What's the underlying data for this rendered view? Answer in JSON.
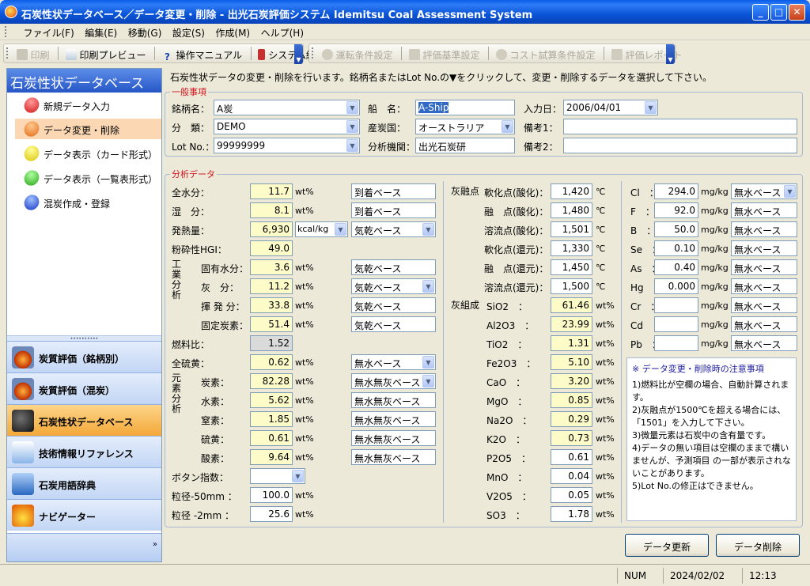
{
  "window": {
    "title": "石炭性状データベース／データ変更・削除 - 出光石炭評価システム Idemitsu Coal Assessment System",
    "min": "_",
    "max": "□",
    "close": "✕"
  },
  "menu": [
    "ファイル(F)",
    "編集(E)",
    "移動(G)",
    "設定(S)",
    "作成(M)",
    "ヘルプ(H)"
  ],
  "toolbar1": [
    "印刷",
    "印刷プレビュー",
    "操作マニュアル",
    "システム終了"
  ],
  "toolbar2": [
    "運転条件設定",
    "評価基準設定",
    "コスト試算条件設定",
    "評価レポート"
  ],
  "sidebar": {
    "header": "石炭性状データベース",
    "items": [
      "新規データ入力",
      "データ変更・削除",
      "データ表示（カード形式）",
      "データ表示（一覧表形式）",
      "混炭作成・登録"
    ],
    "groups": [
      "炭質評価（銘柄別）",
      "炭質評価（混炭）",
      "石炭性状データベース",
      "技術情報リファレンス",
      "石炭用語辞典",
      "ナビゲーター"
    ],
    "more": "»"
  },
  "description": "石炭性状データの変更・削除を行います。銘柄名またはLot No.の▼をクリックして、変更・削除するデータを選択して下さい。",
  "general": {
    "legend": "一般事項",
    "brand_label": "銘柄名：",
    "brand": "A炭",
    "class_label": "分　類：",
    "class": "DEMO",
    "lot_label": "Lot No.：",
    "lot": "99999999",
    "ship_label": "船　名：",
    "ship": "A-Ship",
    "country_label": "産炭国：",
    "country": "オーストラリア",
    "org_label": "分析機関：",
    "org": "出光石炭研",
    "date_label": "入力日：",
    "date": "2006/04/01",
    "note1_label": "備考1：",
    "note1": "",
    "note2_label": "備考2：",
    "note2": ""
  },
  "analysis": {
    "legend": "分析データ",
    "left": [
      {
        "l": "全水分：",
        "v": "11.7",
        "u": "wt%",
        "b": "到着ベース",
        "bd": false
      },
      {
        "l": "湿　分：",
        "v": "8.1",
        "u": "wt%",
        "b": "到着ベース",
        "bd": false
      },
      {
        "l": "発熱量：",
        "v": "6,930",
        "u": "kcal/kg",
        "b": "気乾ベース",
        "bd": true
      },
      {
        "l": "粉砕性HGI：",
        "v": "49.0",
        "u": "",
        "b": "",
        "bd": false
      },
      {
        "l": "固有水分：",
        "v": "3.6",
        "u": "wt%",
        "b": "気乾ベース",
        "bd": false
      },
      {
        "l": "灰　分：",
        "v": "11.2",
        "u": "wt%",
        "b": "気乾ベース",
        "bd": true
      },
      {
        "l": "揮 発 分：",
        "v": "33.8",
        "u": "wt%",
        "b": "気乾ベース",
        "bd": false
      },
      {
        "l": "固定炭素：",
        "v": "51.4",
        "u": "wt%",
        "b": "気乾ベース",
        "bd": false
      },
      {
        "l": "燃料比：",
        "v": "1.52",
        "u": "",
        "b": "",
        "bd": false
      },
      {
        "l": "全硫黄：",
        "v": "0.62",
        "u": "wt%",
        "b": "無水ベース",
        "bd": true
      },
      {
        "l": "炭素：",
        "v": "82.28",
        "u": "wt%",
        "b": "無水無灰ベース",
        "bd": true
      },
      {
        "l": "水素：",
        "v": "5.62",
        "u": "wt%",
        "b": "無水無灰ベース",
        "bd": false
      },
      {
        "l": "窒素：",
        "v": "1.85",
        "u": "wt%",
        "b": "無水無灰ベース",
        "bd": false
      },
      {
        "l": "硫黄：",
        "v": "0.61",
        "u": "wt%",
        "b": "無水無灰ベース",
        "bd": false
      },
      {
        "l": "酸素：",
        "v": "9.64",
        "u": "wt%",
        "b": "無水無灰ベース",
        "bd": false
      },
      {
        "l": "ボタン指数：",
        "v": "",
        "u": "",
        "b": "",
        "bd": false
      },
      {
        "l": "粒径-50mm ：",
        "v": "100.0",
        "u": "wt%",
        "b": "",
        "bd": false
      },
      {
        "l": "粒径 -2mm ：",
        "v": "25.6",
        "u": "wt%",
        "b": "",
        "bd": false
      }
    ],
    "group_industrial": "工業分析",
    "group_elemental": "元素分析",
    "ash_fusion_label": "灰融点",
    "ash_comp_label": "灰組成",
    "middle": [
      {
        "l": "軟化点(酸化)：",
        "v": "1,420",
        "u": "℃"
      },
      {
        "l": "融　点(酸化)：",
        "v": "1,480",
        "u": "℃"
      },
      {
        "l": "溶流点(酸化)：",
        "v": "1,501",
        "u": "℃"
      },
      {
        "l": "軟化点(還元)：",
        "v": "1,330",
        "u": "℃"
      },
      {
        "l": "融　点(還元)：",
        "v": "1,450",
        "u": "℃"
      },
      {
        "l": "溶流点(還元)：",
        "v": "1,500",
        "u": "℃"
      },
      {
        "l": "SiO2　：",
        "v": "61.46",
        "u": "wt%"
      },
      {
        "l": "Al2O3　：",
        "v": "23.99",
        "u": "wt%"
      },
      {
        "l": "TiO2　：",
        "v": "1.31",
        "u": "wt%"
      },
      {
        "l": "Fe2O3　：",
        "v": "5.10",
        "u": "wt%"
      },
      {
        "l": "CaO　：",
        "v": "3.20",
        "u": "wt%"
      },
      {
        "l": "MgO　：",
        "v": "0.85",
        "u": "wt%"
      },
      {
        "l": "Na2O　：",
        "v": "0.29",
        "u": "wt%"
      },
      {
        "l": "K2O　：",
        "v": "0.73",
        "u": "wt%"
      },
      {
        "l": "P2O5　：",
        "v": "0.61",
        "u": "wt%"
      },
      {
        "l": "MnO　：",
        "v": "0.04",
        "u": "wt%"
      },
      {
        "l": "V2O5　：",
        "v": "0.05",
        "u": "wt%"
      },
      {
        "l": "SO3　：",
        "v": "1.78",
        "u": "wt%"
      }
    ],
    "right": [
      {
        "l": "Cl　：",
        "v": "294.0",
        "u": "mg/kg",
        "b": "無水ベース",
        "bd": true
      },
      {
        "l": "F　：",
        "v": "92.0",
        "u": "mg/kg",
        "b": "無水ベース",
        "bd": false
      },
      {
        "l": "B　：",
        "v": "50.0",
        "u": "mg/kg",
        "b": "無水ベース",
        "bd": false
      },
      {
        "l": "Se　：",
        "v": "0.10",
        "u": "mg/kg",
        "b": "無水ベース",
        "bd": false
      },
      {
        "l": "As　：",
        "v": "0.40",
        "u": "mg/kg",
        "b": "無水ベース",
        "bd": false
      },
      {
        "l": "Hg　：",
        "v": "0.000",
        "u": "mg/kg",
        "b": "無水ベース",
        "bd": false
      },
      {
        "l": "Cr　：",
        "v": "",
        "u": "mg/kg",
        "b": "無水ベース",
        "bd": false
      },
      {
        "l": "Cd　：",
        "v": "",
        "u": "mg/kg",
        "b": "無水ベース",
        "bd": false
      },
      {
        "l": "Pb　：",
        "v": "",
        "u": "mg/kg",
        "b": "無水ベース",
        "bd": false
      }
    ]
  },
  "notes": {
    "title": "※ データ変更・削除時の注意事項",
    "lines": [
      "1)燃料比が空欄の場合、自動計算されます。",
      "2)灰融点が1500℃を超える場合には、「1501」を入力して下さい。",
      "3)微量元素は石炭中の含有量です。",
      "4)データの無い項目は空欄のままで構いませんが、予測項目 の一部が表示されないことがあります。",
      "5)Lot No.の修正はできません。"
    ]
  },
  "buttons": {
    "update": "データ更新",
    "delete": "データ削除"
  },
  "status": {
    "num": "NUM",
    "date": "2024/02/02",
    "time": "12:13"
  }
}
